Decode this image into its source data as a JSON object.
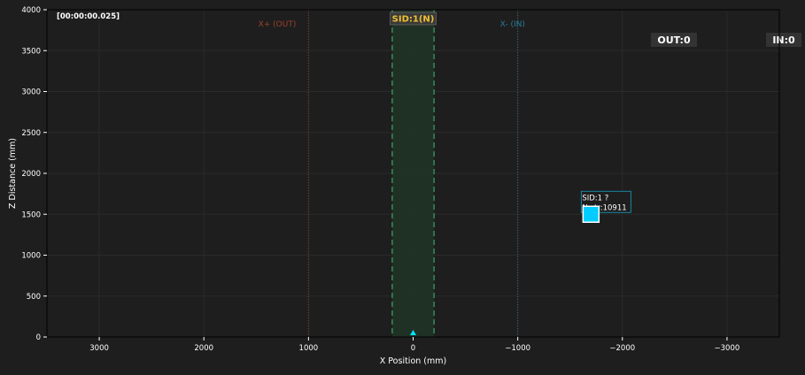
{
  "chart_data": {
    "type": "scatter",
    "timestamp": "[00:00:00.025]",
    "xlabel": "X Position (mm)",
    "ylabel": "Z Distance (mm)",
    "xlim": [
      3500,
      -3500
    ],
    "ylim": [
      0,
      4000
    ],
    "x_reversed": true,
    "grid": true,
    "x_ticks": [
      3000,
      2000,
      1000,
      0,
      -1000,
      -2000,
      -3000
    ],
    "x_tick_labels": [
      "3000",
      "2000",
      "1000",
      "0",
      "−1000",
      "−2000",
      "−3000"
    ],
    "y_ticks": [
      0,
      500,
      1000,
      1500,
      2000,
      2500,
      3000,
      3500,
      4000
    ],
    "y_tick_labels": [
      "0",
      "500",
      "1000",
      "1500",
      "2000",
      "2500",
      "3000",
      "3500",
      "4000"
    ],
    "zones": {
      "out_line_x": 1000,
      "in_line_x": -1000,
      "out_label": "X+ (OUT)",
      "in_label": "X- (IN)",
      "band": [
        200,
        -200
      ],
      "band_label": "SID:1(N)"
    },
    "counters": {
      "out": "OUT:0",
      "in": "IN:0"
    },
    "sensor": {
      "x": 0,
      "y": 0
    },
    "points": [
      {
        "x": -1700,
        "y": 1500,
        "label_line1": "SID:1 ?",
        "label_line2": "N ctr:10911"
      }
    ],
    "colors": {
      "background": "#1e1e1e",
      "plot_border": "#000000",
      "grid": "#2a2a2a",
      "out": "#a0402a",
      "in": "#2a7a9a",
      "band_fill": "#1f3326",
      "band_edge": "#3a8a5a",
      "band_label": "#f0c030",
      "point": "#00ccff",
      "sensor": "#00e5ff",
      "text": "#ffffff"
    }
  }
}
